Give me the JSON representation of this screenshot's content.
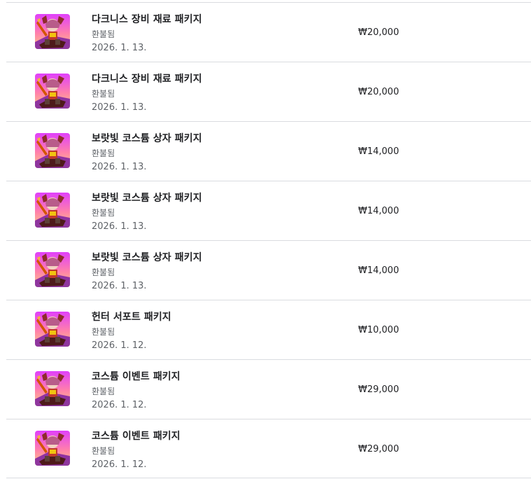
{
  "purchases": [
    {
      "title": "다크니스 장비 재료 패키지",
      "status": "환불됨",
      "date": "2026. 1. 13.",
      "price": "₩20,000",
      "icon": "game-character-icon"
    },
    {
      "title": "다크니스 장비 재료 패키지",
      "status": "환불됨",
      "date": "2026. 1. 13.",
      "price": "₩20,000",
      "icon": "game-character-icon"
    },
    {
      "title": "보랏빛 코스튬 상자 패키지",
      "status": "환불됨",
      "date": "2026. 1. 13.",
      "price": "₩14,000",
      "icon": "game-character-icon"
    },
    {
      "title": "보랏빛 코스튬 상자 패키지",
      "status": "환불됨",
      "date": "2026. 1. 13.",
      "price": "₩14,000",
      "icon": "game-character-icon"
    },
    {
      "title": "보랏빛 코스튬 상자 패키지",
      "status": "환불됨",
      "date": "2026. 1. 13.",
      "price": "₩14,000",
      "icon": "game-character-icon"
    },
    {
      "title": "헌터 서포트 패키지",
      "status": "환불됨",
      "date": "2026. 1. 12.",
      "price": "₩10,000",
      "icon": "game-character-icon"
    },
    {
      "title": "코스튬 이벤트 패키지",
      "status": "환불됨",
      "date": "2026. 1. 12.",
      "price": "₩29,000",
      "icon": "game-character-icon"
    },
    {
      "title": "코스튬 이벤트 패키지",
      "status": "환불됨",
      "date": "2026. 1. 12.",
      "price": "₩29,000",
      "icon": "game-character-icon"
    }
  ],
  "colors": {
    "divider": "#dadce0",
    "text_primary": "#202124",
    "text_secondary": "#5f6368",
    "icon_gradient_top": "#e040fb",
    "icon_gradient_bottom": "#ffb74d"
  }
}
